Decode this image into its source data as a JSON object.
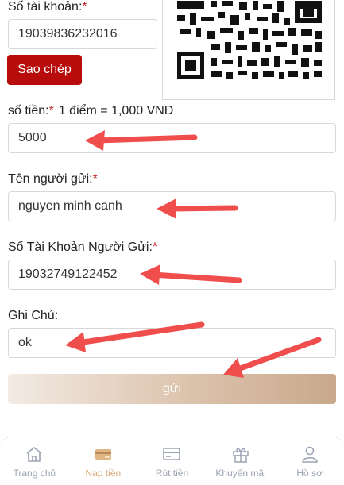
{
  "account": {
    "label": "Số tài khoản:",
    "required": "*",
    "value": "19039836232016",
    "copy_label": "Sao chép"
  },
  "amount": {
    "label": "số tiền:",
    "required": "*",
    "rate": "1 điểm = 1,000 VNĐ",
    "value": "5000"
  },
  "sender_name": {
    "label": "Tên người gửi:",
    "required": "*",
    "value": "nguyen minh canh"
  },
  "sender_account": {
    "label": "Số Tài Khoản Người Gửi:",
    "required": "*",
    "value": "19032749122452"
  },
  "note": {
    "label": "Ghi Chú:",
    "value": "ok"
  },
  "submit_label": "gửi",
  "annotation_color": "#f04d4d",
  "nav": {
    "items": [
      {
        "label": "Trang chủ",
        "icon": "home-icon",
        "active": false
      },
      {
        "label": "Nạp tiền",
        "icon": "wallet-icon",
        "active": true
      },
      {
        "label": "Rút tiền",
        "icon": "card-icon",
        "active": false
      },
      {
        "label": "Khuyến mãi",
        "icon": "gift-icon",
        "active": false
      },
      {
        "label": "Hồ sơ",
        "icon": "user-icon",
        "active": false
      }
    ]
  }
}
